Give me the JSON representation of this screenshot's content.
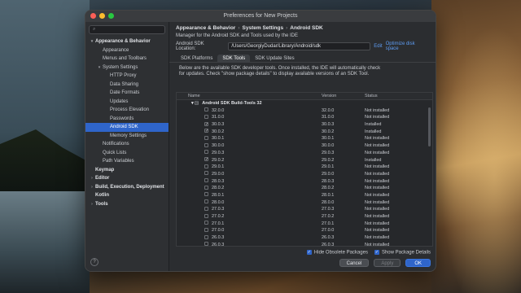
{
  "window": {
    "title": "Preferences for New Projects"
  },
  "sidebar": {
    "search_placeholder": "",
    "items": [
      {
        "label": "Appearance & Behavior",
        "level": 0,
        "bold": true,
        "arrow": "▾"
      },
      {
        "label": "Appearance",
        "level": 1
      },
      {
        "label": "Menus and Toolbars",
        "level": 1
      },
      {
        "label": "System Settings",
        "level": 1,
        "arrow": "▾"
      },
      {
        "label": "HTTP Proxy",
        "level": 2
      },
      {
        "label": "Data Sharing",
        "level": 2
      },
      {
        "label": "Date Formats",
        "level": 2
      },
      {
        "label": "Updates",
        "level": 2
      },
      {
        "label": "Process Elevation",
        "level": 2
      },
      {
        "label": "Passwords",
        "level": 2
      },
      {
        "label": "Android SDK",
        "level": 2,
        "selected": true
      },
      {
        "label": "Memory Settings",
        "level": 2
      },
      {
        "label": "Notifications",
        "level": 1
      },
      {
        "label": "Quick Lists",
        "level": 1
      },
      {
        "label": "Path Variables",
        "level": 1
      },
      {
        "label": "Keymap",
        "level": 0,
        "bold": true
      },
      {
        "label": "Editor",
        "level": 0,
        "bold": true,
        "arrow": "›"
      },
      {
        "label": "Build, Execution, Deployment",
        "level": 0,
        "bold": true,
        "arrow": "›"
      },
      {
        "label": "Kotlin",
        "level": 0,
        "bold": true
      },
      {
        "label": "Tools",
        "level": 0,
        "bold": true,
        "arrow": "›"
      }
    ],
    "help": "?"
  },
  "breadcrumb": {
    "a": "Appearance & Behavior",
    "b": "System Settings",
    "c": "Android SDK",
    "sep": "›"
  },
  "main": {
    "description": "Manager for the Android SDK and Tools used by the IDE",
    "location_label": "Android SDK Location:",
    "location_value": "/Users/GeorgiyDudar/Library/Android/sdk",
    "edit": "Edit",
    "optimize": "Optimize disk space",
    "tabs": [
      "SDK Platforms",
      "SDK Tools",
      "SDK Update Sites"
    ],
    "info_line1": "Below are the available SDK developer tools. Once installed, the IDE will automatically check",
    "info_line2": "for updates. Check \"show package details\" to display available versions of an SDK Tool."
  },
  "table": {
    "headers": {
      "name": "Name",
      "version": "Version",
      "status": "Status"
    },
    "group": "Android SDK Build-Tools 32",
    "rows": [
      {
        "name": "32.0.0",
        "version": "32.0.0",
        "status": "Not installed",
        "checked": false
      },
      {
        "name": "31.0.0",
        "version": "31.0.0",
        "status": "Not installed",
        "checked": false
      },
      {
        "name": "30.0.3",
        "version": "30.0.3",
        "status": "Installed",
        "checked": true
      },
      {
        "name": "30.0.2",
        "version": "30.0.2",
        "status": "Installed",
        "checked": true
      },
      {
        "name": "30.0.1",
        "version": "30.0.1",
        "status": "Not installed",
        "checked": false
      },
      {
        "name": "30.0.0",
        "version": "30.0.0",
        "status": "Not installed",
        "checked": false
      },
      {
        "name": "29.0.3",
        "version": "29.0.3",
        "status": "Not installed",
        "checked": false
      },
      {
        "name": "29.0.2",
        "version": "29.0.2",
        "status": "Installed",
        "checked": true
      },
      {
        "name": "29.0.1",
        "version": "29.0.1",
        "status": "Not installed",
        "checked": false
      },
      {
        "name": "29.0.0",
        "version": "29.0.0",
        "status": "Not installed",
        "checked": false
      },
      {
        "name": "28.0.3",
        "version": "28.0.3",
        "status": "Not installed",
        "checked": false
      },
      {
        "name": "28.0.2",
        "version": "28.0.2",
        "status": "Not installed",
        "checked": false
      },
      {
        "name": "28.0.1",
        "version": "28.0.1",
        "status": "Not installed",
        "checked": false
      },
      {
        "name": "28.0.0",
        "version": "28.0.0",
        "status": "Not installed",
        "checked": false
      },
      {
        "name": "27.0.3",
        "version": "27.0.3",
        "status": "Not installed",
        "checked": false
      },
      {
        "name": "27.0.2",
        "version": "27.0.2",
        "status": "Not installed",
        "checked": false
      },
      {
        "name": "27.0.1",
        "version": "27.0.1",
        "status": "Not installed",
        "checked": false
      },
      {
        "name": "27.0.0",
        "version": "27.0.0",
        "status": "Not installed",
        "checked": false
      },
      {
        "name": "26.0.3",
        "version": "26.0.3",
        "status": "Not installed",
        "checked": false
      },
      {
        "name": "26.0.3",
        "version": "26.0.3",
        "status": "Not installed",
        "checked": false
      }
    ]
  },
  "options": {
    "hide_obsolete": "Hide Obsolete Packages",
    "show_details": "Show Package Details"
  },
  "footer": {
    "cancel": "Cancel",
    "apply": "Apply",
    "ok": "OK"
  }
}
